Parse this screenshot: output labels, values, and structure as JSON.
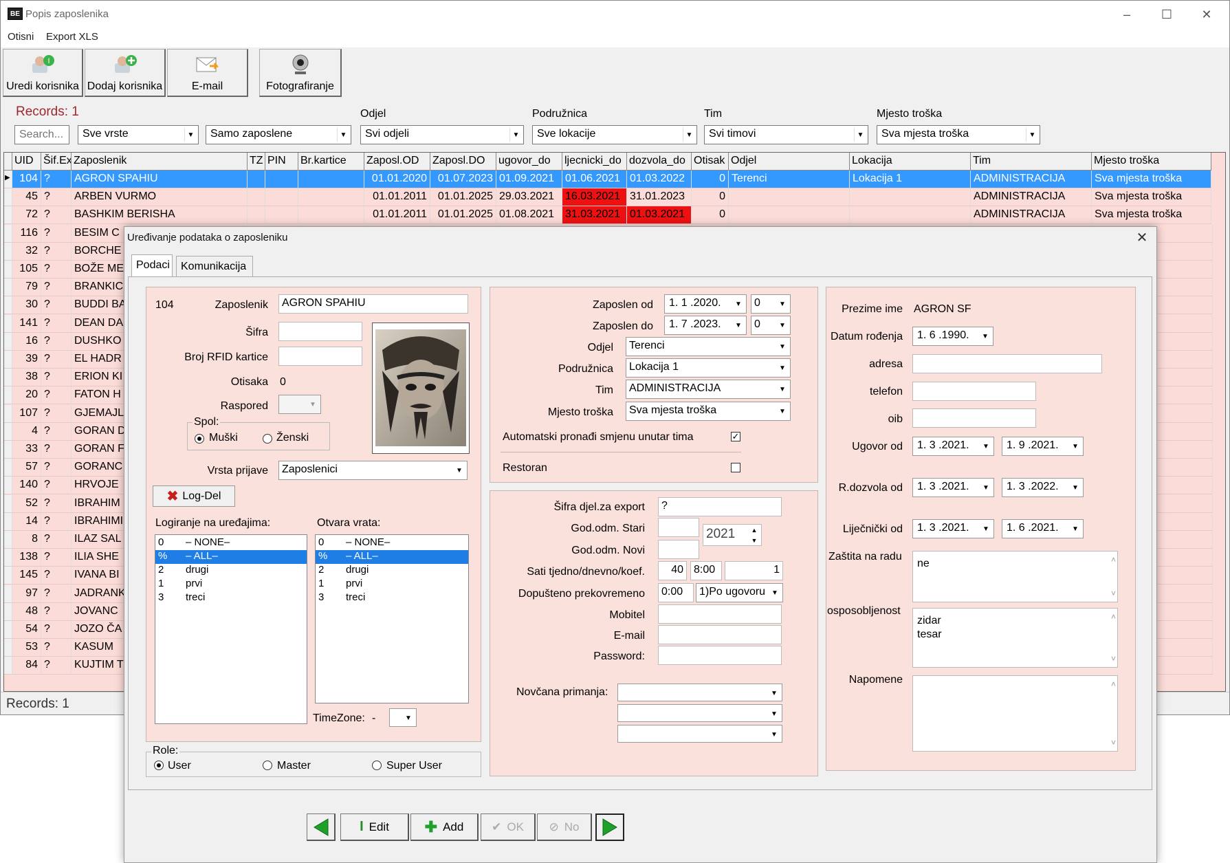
{
  "window": {
    "title": "Popis zaposlenika",
    "app_icon_text": "BE",
    "controls": [
      "minimize-icon",
      "maximize-icon",
      "close-icon"
    ]
  },
  "menu": [
    "Otisni",
    "Export XLS"
  ],
  "toolbar": [
    {
      "label": "Uredi korisnika",
      "icon": "edit-user-icon"
    },
    {
      "label": "Dodaj korisnika",
      "icon": "add-user-icon"
    },
    {
      "label": "E-mail",
      "icon": "email-icon"
    },
    {
      "label": "Fotografiranje",
      "icon": "webcam-icon"
    }
  ],
  "filters": {
    "records": "Records: 1",
    "search_placeholder": "Search...",
    "vrste": "Sve vrste",
    "zaposleni": "Samo zaposlene",
    "odjel_label": "Odjel",
    "odjel": "Svi odjeli",
    "podruznica_label": "Podružnica",
    "podruznica": "Sve lokacije",
    "tim_label": "Tim",
    "tim": "Svi timovi",
    "mjesto_label": "Mjesto troška",
    "mjesto": "Sva mjesta troška"
  },
  "grid": {
    "columns": [
      "UID",
      "Šif.Ex",
      "Zaposlenik",
      "TZ",
      "PIN",
      "Br.kartice",
      "Zaposl.OD",
      "Zaposl.DO",
      "ugovor_do",
      "ljecnicki_do",
      "dozvola_do",
      "Otisak",
      "Odjel",
      "Lokacija",
      "Tim",
      "Mjesto troška"
    ],
    "rows": [
      [
        "104",
        "?",
        "AGRON SPAHIU",
        "",
        "",
        "",
        "01.01.2020",
        "01.07.2023",
        "01.09.2021",
        "01.06.2021",
        "01.03.2022",
        "0",
        "Terenci",
        "Lokacija 1",
        "ADMINISTRACIJA",
        "Sva mjesta troška"
      ],
      [
        "45",
        "?",
        "ARBEN VURMO",
        "",
        "",
        "",
        "01.01.2011",
        "01.01.2025",
        "29.03.2021",
        "16.03.2021",
        "31.01.2023",
        "0",
        "",
        "",
        "ADMINISTRACIJA",
        "Sva mjesta troška"
      ],
      [
        "72",
        "?",
        "BASHKIM BERISHA",
        "",
        "",
        "",
        "01.01.2011",
        "01.01.2025",
        "01.08.2021",
        "31.03.2021",
        "01.03.2021",
        "0",
        "",
        "",
        "ADMINISTRACIJA",
        "Sva mjesta troška"
      ],
      [
        "116",
        "?",
        "BESIM C",
        "",
        "",
        "",
        "",
        "",
        "",
        "",
        "",
        "",
        "",
        "",
        "",
        "a troška"
      ],
      [
        "32",
        "?",
        "BORCHE",
        "",
        "",
        "",
        "",
        "",
        "",
        "",
        "",
        "",
        "",
        "",
        "",
        "a troška"
      ],
      [
        "105",
        "?",
        "BOŽE ME",
        "",
        "",
        "",
        "",
        "",
        "",
        "",
        "",
        "",
        "",
        "",
        "",
        "a troška"
      ],
      [
        "79",
        "?",
        "BRANKIC",
        "",
        "",
        "",
        "",
        "",
        "",
        "",
        "",
        "",
        "",
        "",
        "",
        "a troška"
      ],
      [
        "30",
        "?",
        "BUDDI BA",
        "",
        "",
        "",
        "",
        "",
        "",
        "",
        "",
        "",
        "",
        "",
        "",
        "a troška"
      ],
      [
        "141",
        "?",
        "DEAN DA",
        "",
        "",
        "",
        "",
        "",
        "",
        "",
        "",
        "",
        "",
        "",
        "",
        "a troška"
      ],
      [
        "16",
        "?",
        "DUSHKO",
        "",
        "",
        "",
        "",
        "",
        "",
        "",
        "",
        "",
        "",
        "",
        "",
        "a troška"
      ],
      [
        "39",
        "?",
        "EL HADR",
        "",
        "",
        "",
        "",
        "",
        "",
        "",
        "",
        "",
        "",
        "",
        "",
        "a troška"
      ],
      [
        "38",
        "?",
        "ERION KI",
        "",
        "",
        "",
        "",
        "",
        "",
        "",
        "",
        "",
        "",
        "",
        "",
        "a troška"
      ],
      [
        "20",
        "?",
        "FATON H",
        "",
        "",
        "",
        "",
        "",
        "",
        "",
        "",
        "",
        "",
        "",
        "",
        "a troška"
      ],
      [
        "107",
        "?",
        "GJEMAJL",
        "",
        "",
        "",
        "",
        "",
        "",
        "",
        "",
        "",
        "",
        "",
        "",
        "a troška"
      ],
      [
        "4",
        "?",
        "GORAN D",
        "",
        "",
        "",
        "",
        "",
        "",
        "",
        "",
        "",
        "",
        "",
        "",
        "a troška"
      ],
      [
        "33",
        "?",
        "GORAN F",
        "",
        "",
        "",
        "",
        "",
        "",
        "",
        "",
        "",
        "",
        "",
        "",
        "a troška"
      ],
      [
        "57",
        "?",
        "GORANC",
        "",
        "",
        "",
        "",
        "",
        "",
        "",
        "",
        "",
        "",
        "",
        "",
        "a troška"
      ],
      [
        "140",
        "?",
        "HRVOJE",
        "",
        "",
        "",
        "",
        "",
        "",
        "",
        "",
        "",
        "",
        "",
        "",
        "a troška"
      ],
      [
        "52",
        "?",
        "IBRAHIM",
        "",
        "",
        "",
        "",
        "",
        "",
        "",
        "",
        "",
        "",
        "",
        "",
        "a troška"
      ],
      [
        "14",
        "?",
        "IBRAHIMI",
        "",
        "",
        "",
        "",
        "",
        "",
        "",
        "",
        "",
        "",
        "",
        "",
        "a troška"
      ],
      [
        "8",
        "?",
        "ILAZ SAL",
        "",
        "",
        "",
        "",
        "",
        "",
        "",
        "",
        "",
        "",
        "",
        "",
        "a troška"
      ],
      [
        "138",
        "?",
        "ILIA SHE",
        "",
        "",
        "",
        "",
        "",
        "",
        "",
        "",
        "",
        "",
        "",
        "",
        "a troška"
      ],
      [
        "145",
        "?",
        "IVANA BI",
        "",
        "",
        "",
        "",
        "",
        "",
        "",
        "",
        "",
        "",
        "",
        "",
        "a troška"
      ],
      [
        "97",
        "?",
        "JADRANK",
        "",
        "",
        "",
        "",
        "",
        "",
        "",
        "",
        "",
        "",
        "",
        "",
        "a troška"
      ],
      [
        "48",
        "?",
        "JOVANC",
        "",
        "",
        "",
        "",
        "",
        "",
        "",
        "",
        "",
        "",
        "",
        "",
        "a troška"
      ],
      [
        "54",
        "?",
        "JOZO ČA",
        "",
        "",
        "",
        "",
        "",
        "",
        "",
        "",
        "",
        "",
        "",
        "",
        "a troška"
      ],
      [
        "53",
        "?",
        "KASUM",
        "",
        "",
        "",
        "",
        "",
        "",
        "",
        "",
        "",
        "",
        "",
        "",
        "a troška"
      ],
      [
        "84",
        "?",
        "KUJTIM T",
        "",
        "",
        "",
        "",
        "",
        "",
        "",
        "",
        "",
        "",
        "",
        "",
        "a troška"
      ]
    ],
    "highlight_color": "#ee1111"
  },
  "status": {
    "records": "Records: 1"
  },
  "dialog": {
    "title": "Uređivanje podataka o zaposleniku",
    "tabs": [
      "Podaci",
      "Komunikacija"
    ],
    "left": {
      "uid": "104",
      "zaposlenik_label": "Zaposlenik",
      "zaposlenik": "AGRON SPAHIU",
      "sifra_label": "Šifra",
      "sifra": "",
      "rfid_label": "Broj RFID kartice",
      "rfid": "",
      "otisaka_label": "Otisaka",
      "otisaka": "0",
      "raspored_label": "Raspored",
      "spol_label": "Spol:",
      "muski": "Muški",
      "zenski": "Ženski",
      "vrsta_label": "Vrsta prijave",
      "vrsta": "Zaposlenici",
      "logdel": "Log-Del",
      "logiranje_label": "Logiranje na uređajima:",
      "otvara_label": "Otvara vrata:",
      "devices": [
        {
          "code": "0",
          "name": "– NONE–"
        },
        {
          "code": "%",
          "name": "– ALL–"
        },
        {
          "code": "2",
          "name": "drugi"
        },
        {
          "code": "1",
          "name": "prvi"
        },
        {
          "code": "3",
          "name": "treci"
        }
      ],
      "timezone_label": "TimeZone:",
      "timezone": "-",
      "role_label": "Role:",
      "roles": [
        "User",
        "Master",
        "Super User"
      ]
    },
    "mid": {
      "zaposlen_od_label": "Zaposlen od",
      "zaposlen_od": "1. 1 .2020.",
      "zaposlen_od_n": "0",
      "zaposlen_do_label": "Zaposlen do",
      "zaposlen_do": "1. 7 .2023.",
      "zaposlen_do_n": "0",
      "odjel_label": "Odjel",
      "odjel": "Terenci",
      "podruznica_label": "Podružnica",
      "podruznica": "Lokacija 1",
      "tim_label": "Tim",
      "tim": "ADMINISTRACIJA",
      "mjesto_label": "Mjesto troška",
      "mjesto": "Sva mjesta troška",
      "auto_label": "Automatski pronađi smjenu unutar tima",
      "restoran_label": "Restoran",
      "sifra_export_label": "Šifra djel.za export",
      "sifra_export": "?",
      "god_stari_label": "God.odm. Stari",
      "god_novi_label": "God.odm. Novi",
      "year": "2021",
      "sati_label": "Sati tjedno/dnevno/koef.",
      "sati_tjedno": "40",
      "sati_dnevno": "8:00",
      "koef": "1",
      "prekovremeno_label": "Dopušteno prekovremeno",
      "prekovremeno": "0:00",
      "ugovor_opt": "1)Po ugovoru",
      "mobitel_label": "Mobitel",
      "email_label": "E-mail",
      "password_label": "Password:",
      "novcana_label": "Novčana primanja:"
    },
    "right": {
      "prezime_label": "Prezime ime",
      "prezime": "AGRON SF",
      "datum_label": "Datum rođenja",
      "datum": "1. 6 .1990.",
      "adresa_label": "adresa",
      "telefon_label": "telefon",
      "oib_label": "oib",
      "ugovor_label": "Ugovor od",
      "ugovor_od": "1. 3 .2021.",
      "ugovor_do": "1. 9 .2021.",
      "rdozvola_label": "R.dozvola od",
      "rdozvola_od": "1. 3 .2021.",
      "rdozvola_do": "1. 3 .2022.",
      "ljecnicki_label": "Liječnički od",
      "ljecnicki_od": "1. 3 .2021.",
      "ljecnicki_do": "1. 6 .2021.",
      "zastita_label": "Zaštita na radu",
      "zastita": "ne",
      "osposob_label": "osposobljenost",
      "osposob": "zidar\ntesar",
      "napomene_label": "Napomene",
      "napomene": ""
    },
    "nav": {
      "edit": "Edit",
      "add": "Add",
      "ok": "OK",
      "no": "No"
    }
  },
  "colors": {
    "panel": "#fbe1dc",
    "selection": "#3399ff",
    "expired": "#ee1111"
  }
}
